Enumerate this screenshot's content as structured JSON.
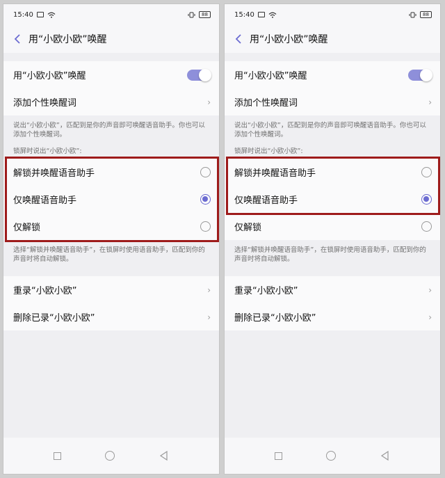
{
  "colors": {
    "accent": "#6b6bd1",
    "toggle_on": "#8e8fda",
    "highlight": "#9e1b1b"
  },
  "screens": [
    {
      "status": {
        "time": "15:40",
        "battery": "88"
      },
      "title": "用“小欧小欧”唤醒",
      "wake_label": "用“小欧小欧”唤醒",
      "wake_enabled": true,
      "add_word_label": "添加个性唤醒词",
      "note_1": "说出“小欧小欧”，匹配到是你的声音即可唤醒语音助手。你也可以添加个性唤醒词。",
      "lock_label": "锁屏时说出“小欧小欧”:",
      "options": [
        {
          "label": "解锁并唤醒语音助手",
          "selected": false
        },
        {
          "label": "仅唤醒语音助手",
          "selected": true
        },
        {
          "label": "仅解锁",
          "selected": false
        }
      ],
      "note_2": "选择“解锁并唤醒语音助手”，在锁屏时使用语音助手，匹配到你的声音时将自动解锁。",
      "rerecord_label": "重录“小欧小欧”",
      "delete_label": "删除已录“小欧小欧”",
      "highlighted_options": 3
    },
    {
      "status": {
        "time": "15:40",
        "battery": "88"
      },
      "title": "用“小欧小欧”唤醒",
      "wake_label": "用“小欧小欧”唤醒",
      "wake_enabled": true,
      "add_word_label": "添加个性唤醒词",
      "note_1": "说出“小欧小欧”，匹配到是你的声音即可唤醒语音助手。你也可以添加个性唤醒词。",
      "lock_label": "锁屏时说出“小欧小欧”:",
      "options": [
        {
          "label": "解锁并唤醒语音助手",
          "selected": false
        },
        {
          "label": "仅唤醒语音助手",
          "selected": true
        },
        {
          "label": "仅解锁",
          "selected": false
        }
      ],
      "note_2": "选择“解锁并唤醒语音助手”，在锁屏时使用语音助手，匹配到你的声音时将自动解锁。",
      "rerecord_label": "重录“小欧小欧”",
      "delete_label": "删除已录“小欧小欧”",
      "highlighted_options": 2
    }
  ]
}
